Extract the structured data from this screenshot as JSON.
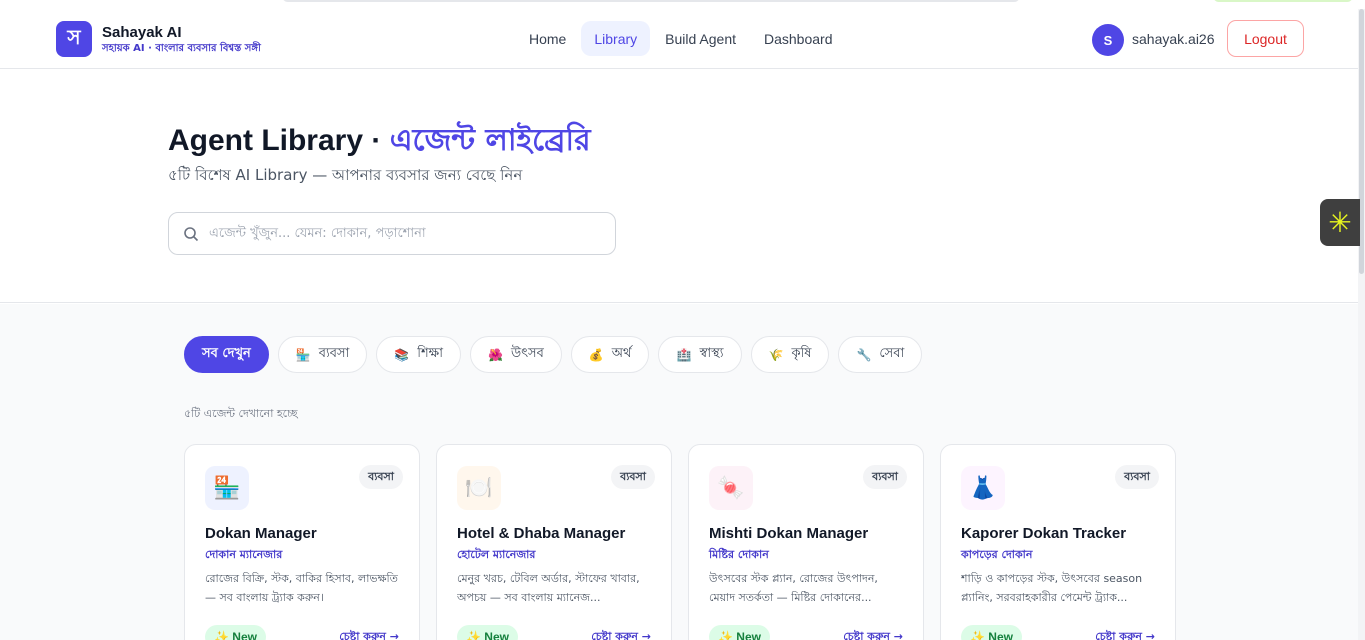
{
  "header": {
    "brand_name": "Sahayak AI",
    "brand_tagline": "সহায়ক AI · বাংলার ব্যবসার বিশ্বস্ত সঙ্গী",
    "logo_letter": "স",
    "nav": [
      {
        "label": "Home",
        "active": false
      },
      {
        "label": "Library",
        "active": true
      },
      {
        "label": "Build Agent",
        "active": false
      },
      {
        "label": "Dashboard",
        "active": false
      }
    ],
    "user_initial": "S",
    "user_name": "sahayak.ai26",
    "logout_label": "Logout"
  },
  "hero": {
    "title_en": "Agent Library",
    "title_sep": " · ",
    "title_bn": "এজেন্ট লাইব্রেরি",
    "subtitle": "৫টি বিশেষ AI Library — আপনার ব্যবসার জন্য বেছে নিন",
    "search_placeholder": "এজেন্ট খুঁজুন... যেমন: দোকান, পড়াশোনা"
  },
  "filters": [
    {
      "label": "সব দেখুন",
      "icon": "",
      "active": true
    },
    {
      "label": "ব্যবসা",
      "icon": "🏪",
      "active": false
    },
    {
      "label": "শিক্ষা",
      "icon": "📚",
      "active": false
    },
    {
      "label": "উৎসব",
      "icon": "🌺",
      "active": false
    },
    {
      "label": "অর্থ",
      "icon": "💰",
      "active": false
    },
    {
      "label": "স্বাস্থ্য",
      "icon": "🏥",
      "active": false
    },
    {
      "label": "কৃষি",
      "icon": "🌾",
      "active": false
    },
    {
      "label": "সেবা",
      "icon": "🔧",
      "active": false
    }
  ],
  "results_count": "৫টি এজেন্ট দেখানো হচ্ছে",
  "cards": [
    {
      "icon": "🏪",
      "badge": "ব্যবসা",
      "title": "Dokan Manager",
      "subtitle": "দোকান ম্যানেজার",
      "desc": "রোজের বিক্রি, স্টক, বাকির হিসাব, লাভক্ষতি — সব বাংলায় ট্র্যাক করুন।",
      "new_label": "✨ New",
      "try_label": "চেষ্টা করুন →",
      "icon_bg": "#eef2ff"
    },
    {
      "icon": "🍽️",
      "badge": "ব্যবসা",
      "title": "Hotel & Dhaba Manager",
      "subtitle": "হোটেল ম্যানেজার",
      "desc": "মেনুর খরচ, টেবিল অর্ডার, স্টাফের খাবার, অপচয় — সব বাংলায় ম্যানেজ...",
      "new_label": "✨ New",
      "try_label": "চেষ্টা করুন →",
      "icon_bg": "#fff7ed"
    },
    {
      "icon": "🍬",
      "badge": "ব্যবসা",
      "title": "Mishti Dokan Manager",
      "subtitle": "মিষ্টির দোকান",
      "desc": "উৎসবের স্টক প্ল্যান, রোজের উৎপাদন, মেয়াদ সতর্কতা — মিষ্টির দোকানের...",
      "new_label": "✨ New",
      "try_label": "চেষ্টা করুন →",
      "icon_bg": "#fdf2f8"
    },
    {
      "icon": "👗",
      "badge": "ব্যবসা",
      "title": "Kaporer Dokan Tracker",
      "subtitle": "কাপড়ের দোকান",
      "desc": "শাড়ি ও কাপড়ের স্টক, উৎসবের season প্ল্যানিং, সরবরাহকারীর পেমেন্ট ট্র্যাক...",
      "new_label": "✨ New",
      "try_label": "চেষ্টা করুন →",
      "icon_bg": "#fdf4ff"
    }
  ]
}
